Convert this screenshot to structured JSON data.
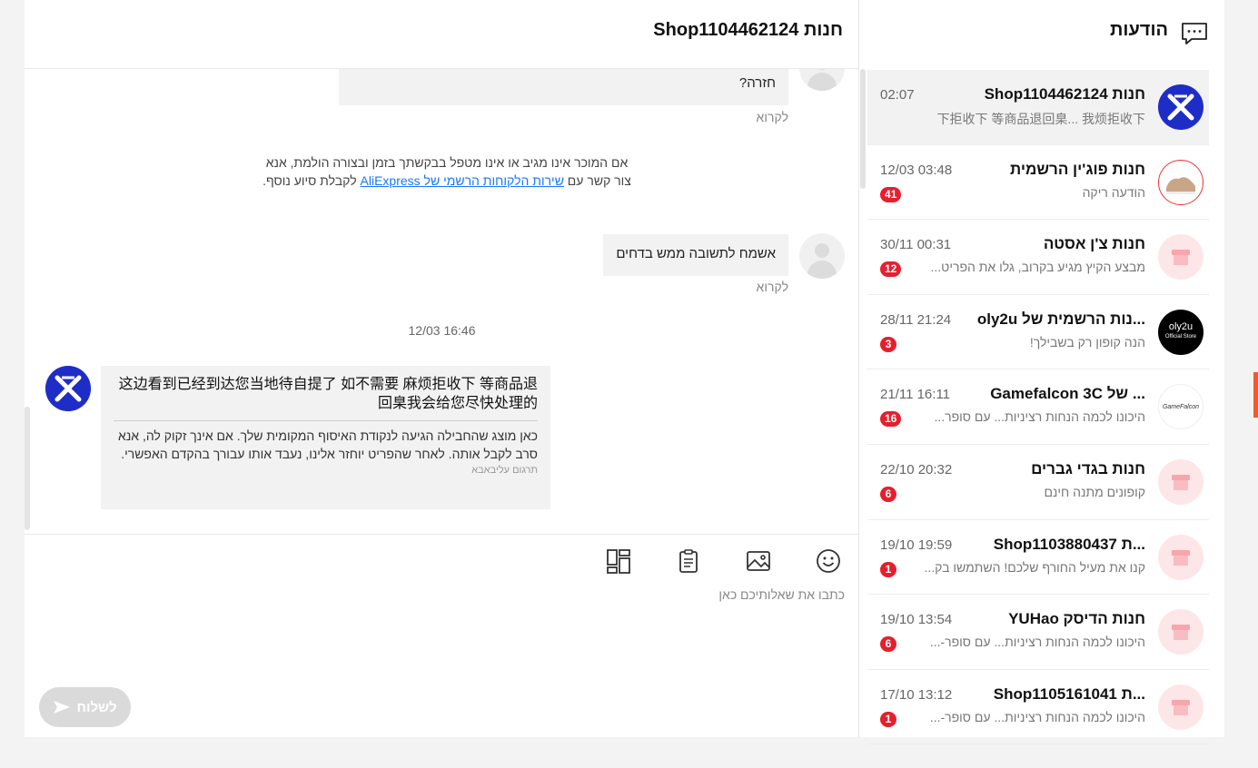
{
  "chat": {
    "title": "חנות Shop1104462124",
    "top_bubble": {
      "text": "חזרה?"
    },
    "read_label_1": "לקרוא",
    "system_note": {
      "line1": "אם המוכר אינו מגיב או אינו מטפל בבקשתך בזמן ובצורה הולמת, אנא",
      "prefix": "צור קשר עם ",
      "link": "שירות הלקוחות הרשמי של AliExpress",
      "suffix": " לקבלת סיוע נוסף."
    },
    "my_message": "אשמח לתשובה ממש בדחים",
    "read_label_2": "לקרוא",
    "time_divider": "12/03 16:46",
    "shop_message": {
      "original": "这边看到已经到达您当地待自提了 如不需要 麻烦拒收下 等商品退回臬我会给您尽快处理的",
      "translation": "כאן מוצג שהחבילה הגיעה לנקודת האיסוף המקומית שלך. אם אינך זקוק לה, אנא סרב לקבל אותה. לאחר שהפריט יוחזר אלינו, נעבד אותו עבורך בהקדם האפשרי.",
      "translated_by": "תרגום עליבאבא"
    },
    "composer": {
      "placeholder": "כתבו את שאלותיכם כאן",
      "send_label": "לשלוח"
    }
  },
  "conversations": {
    "title": "הודעות",
    "items": [
      {
        "name": "חנות Shop1104462124",
        "time": "02:07",
        "preview": "下拒收下 等商品退回臬... 我烦拒收下",
        "badge": "",
        "avatar": "x-logo"
      },
      {
        "name": "חנות פוג'ין הרשמית",
        "time": "12/03 03:48",
        "preview": "הודעה ריקה",
        "badge": "41",
        "avatar": "fajia"
      },
      {
        "name": "חנות צ'ן אסטה",
        "time": "30/11 00:31",
        "preview": "מבצע הקיץ מגיע בקרוב, גלו את הפריט...",
        "badge": "12",
        "avatar": "store"
      },
      {
        "name": "...נות הרשמית של oly2u",
        "time": "28/11 21:24",
        "preview": "הנה קופון רק בשבילך!",
        "badge": "3",
        "avatar": "oly2u"
      },
      {
        "name": "... של Gamefalcon 3C",
        "time": "21/11 16:11",
        "preview": "היכונו לכמה הנחות רציניות... עם סופר...",
        "badge": "16",
        "avatar": "gamefalcon"
      },
      {
        "name": "חנות בגדי גברים",
        "time": "22/10 20:32",
        "preview": "קופונים מתנה חינם",
        "badge": "6",
        "avatar": "store"
      },
      {
        "name": "...ת Shop1103880437",
        "time": "19/10 19:59",
        "preview": "קנו את מעיל החורף שלכם! השתמשו בק...",
        "badge": "1",
        "avatar": "store"
      },
      {
        "name": "חנות הדיסק YUHao",
        "time": "19/10 13:54",
        "preview": "היכונו לכמה הנחות רציניות... עם סופר-...",
        "badge": "6",
        "avatar": "store"
      },
      {
        "name": "...ת Shop1105161041",
        "time": "17/10 13:12",
        "preview": "היכונו לכמה הנחות רציניות... עם סופר-...",
        "badge": "1",
        "avatar": "store"
      }
    ]
  },
  "avatar_text": {
    "oly2u": "oly2u",
    "oly2u_sub": "Official Store",
    "gamefalcon": "GameFalcon"
  },
  "colors": {
    "accent": "#1677ff",
    "badge": "#e51f2d",
    "shop_logo_bg": "#1f2dc7",
    "store_avatar_bg": "#fde6e8"
  }
}
